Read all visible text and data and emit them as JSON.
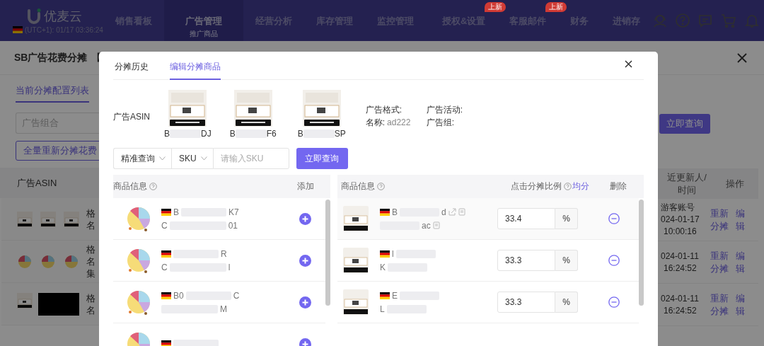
{
  "nav": {
    "logo": "优麦云",
    "clock": "(UTC+1): 01/17 03:36:24",
    "items": [
      {
        "label": "销售看板",
        "selected": false
      },
      {
        "label": "广告管理",
        "sub": "推广商品",
        "selected": true
      },
      {
        "label": "经营分析",
        "selected": false
      },
      {
        "label": "库存管理",
        "selected": false
      },
      {
        "label": "监控管理",
        "selected": false
      },
      {
        "label": "授权&设置",
        "badge": "上新",
        "selected": false
      },
      {
        "label": "客服邮件",
        "badge": "上新",
        "selected": false
      },
      {
        "label": "财务",
        "selected": false
      },
      {
        "label": "进销存",
        "selected": false
      }
    ]
  },
  "page": {
    "title": "SB广告花费分摊",
    "title_bracket": "【",
    "tab": "当前分摊配置列表",
    "filter_placeholder": "广告组合",
    "reallocate_button": "全量重新分摊花费",
    "query_button": "立即查询",
    "table": {
      "column_asin": "广告ASIN",
      "column_updated": [
        "近更新人/",
        "时间"
      ],
      "column_actions": "操作",
      "rows": [
        {
          "images": [
            {
              "kind": "kitchen"
            },
            {
              "kind": "kitchen"
            },
            {
              "kind": "kitchen"
            }
          ],
          "text": [
            "格",
            "名"
          ],
          "updater": "游客账号",
          "date": "024-01-17",
          "time": "10:00:16",
          "actions": [
            "重新分摊",
            "编辑"
          ]
        },
        {
          "images": [
            {
              "kind": "fan"
            },
            {
              "kind": "fan"
            },
            {
              "kind": "fan"
            }
          ],
          "text": [
            "格",
            "名",
            "集"
          ],
          "date": "024-01-11",
          "time": "16:24:52",
          "actions": [
            "重新分摊",
            "编辑"
          ]
        },
        {
          "images": [
            {
              "kind": "kitchen"
            },
            {
              "kind": "black"
            }
          ],
          "text": [
            "格",
            "名"
          ],
          "date": "024-01-11",
          "time": "16:24:52",
          "actions": [
            "重新分摊",
            "编辑"
          ]
        }
      ]
    }
  },
  "modal": {
    "tabs": [
      {
        "label": "分摊历史",
        "selected": false
      },
      {
        "label": "编辑分摊商品",
        "selected": true
      }
    ],
    "ad_asin_label": "广告ASIN",
    "ad_asins": [
      {
        "prefix": "B",
        "suffix": "DJ"
      },
      {
        "prefix": "B",
        "suffix": "F6"
      },
      {
        "prefix": "B",
        "suffix": "SP"
      }
    ],
    "ad_info": [
      {
        "label": "广告格式:"
      },
      {
        "label": "名称:",
        "value": "ad222"
      },
      {
        "label": "广告活动:"
      },
      {
        "label": "广告组:"
      }
    ],
    "filters": {
      "match_mode": "精准查询",
      "field": "SKU",
      "placeholder": "请输入SKU",
      "button": "立即查询"
    },
    "candidates": {
      "columns": [
        "商品信息",
        "添加"
      ],
      "rows": [
        {
          "asin": {
            "prefix": "B",
            "suffix": "K7"
          },
          "sku": {
            "prefix": "C",
            "suffix": "01"
          }
        },
        {
          "asin": {
            "suffix": "R"
          },
          "sku": {
            "prefix": "C",
            "suffix": "l"
          }
        },
        {
          "asin": {
            "prefix": "B0",
            "suffix": "C"
          },
          "sku": {
            "suffix": "M"
          }
        },
        {
          "asin": {}
        }
      ]
    },
    "selected_products": {
      "columns": [
        "商品信息",
        "点击分摊比例",
        "删除"
      ],
      "split_evenly": "均分",
      "rows": [
        {
          "asin": {
            "prefix": "B",
            "suffix": "d"
          },
          "sku": {
            "suffix": "ac"
          },
          "ratio": "33.4",
          "unit": "%",
          "highlighted": true
        },
        {
          "asin": {
            "prefix": "l"
          },
          "sku": {
            "prefix": "K"
          },
          "ratio": "33.3",
          "unit": "%",
          "highlighted": false
        },
        {
          "asin": {
            "prefix": "E"
          },
          "sku": {
            "prefix": "L"
          },
          "ratio": "33.3",
          "unit": "%",
          "highlighted": false
        }
      ]
    }
  }
}
